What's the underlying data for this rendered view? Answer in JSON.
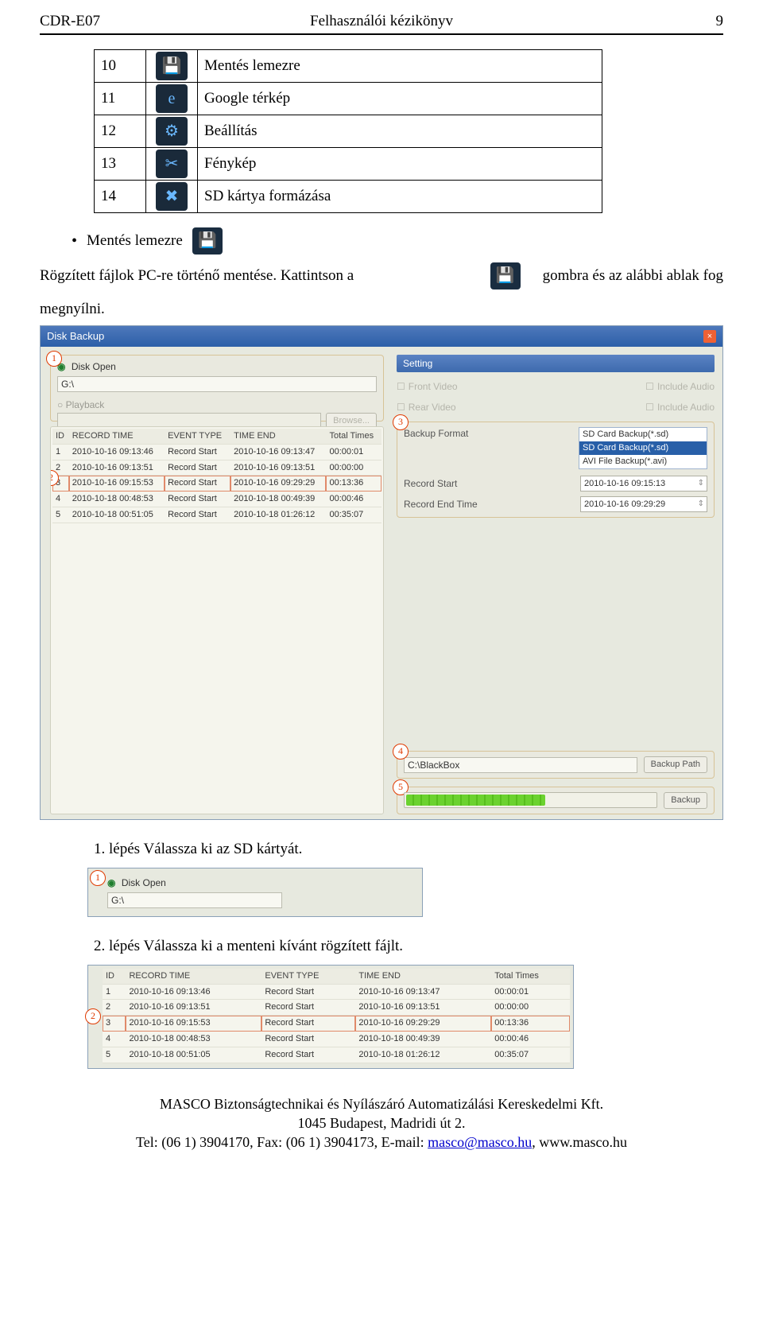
{
  "header": {
    "left": "CDR-E07",
    "center": "Felhasználói kézikönyv",
    "right": "9"
  },
  "iconTable": {
    "rows": [
      {
        "num": "10",
        "icon": "save-icon",
        "glyph": "💾",
        "label": "Mentés lemezre"
      },
      {
        "num": "11",
        "icon": "google-maps-icon",
        "glyph": "e",
        "label": "Google térkép"
      },
      {
        "num": "12",
        "icon": "settings-icon",
        "glyph": "⚙",
        "label": "Beállítás"
      },
      {
        "num": "13",
        "icon": "snapshot-icon",
        "glyph": "✂",
        "label": "Fénykép"
      },
      {
        "num": "14",
        "icon": "format-sd-icon",
        "glyph": "✖",
        "label": "SD kártya formázása"
      }
    ]
  },
  "bullet": {
    "text": "Mentés lemezre",
    "iconName": "save-icon",
    "glyph": "💾"
  },
  "paragraph": {
    "segA": "Rögzített  fájlok  PC-re  történő  mentése.  Kattintson  a",
    "iconName": "save-icon",
    "glyph": "💾",
    "segB": "gombra  és  az  alábbi  ablak  fog",
    "line2": "megnyílni."
  },
  "diskBackup": {
    "title": "Disk Backup",
    "markers": {
      "m1": "1",
      "m2": "2",
      "m3": "3",
      "m4": "4",
      "m5": "5"
    },
    "left": {
      "diskOpen": {
        "label": "Disk Open",
        "value": "G:\\"
      },
      "playback": {
        "label": "Playback",
        "browse": "Browse..."
      },
      "columns": [
        "ID",
        "RECORD TIME",
        "EVENT TYPE",
        "TIME END",
        "Total Times"
      ],
      "rows": [
        {
          "id": "1",
          "rt": "2010-10-16 09:13:46",
          "et": "Record Start",
          "te": "2010-10-16 09:13:47",
          "tt": "00:00:01"
        },
        {
          "id": "2",
          "rt": "2010-10-16 09:13:51",
          "et": "Record Start",
          "te": "2010-10-16 09:13:51",
          "tt": "00:00:00"
        },
        {
          "id": "3",
          "rt": "2010-10-16 09:15:53",
          "et": "Record Start",
          "te": "2010-10-16 09:29:29",
          "tt": "00:13:36",
          "hl": true
        },
        {
          "id": "4",
          "rt": "2010-10-18 00:48:53",
          "et": "Record Start",
          "te": "2010-10-18 00:49:39",
          "tt": "00:00:46"
        },
        {
          "id": "5",
          "rt": "2010-10-18 00:51:05",
          "et": "Record Start",
          "te": "2010-10-18 01:26:12",
          "tt": "00:35:07"
        }
      ]
    },
    "right": {
      "settingHead": "Setting",
      "frontVideo": "Front Video",
      "rearVideo": "Rear Video",
      "includeAudio": "Include Audio",
      "backupFormatLabel": "Backup Format",
      "formats": [
        {
          "text": "SD Card Backup(*.sd)",
          "sel": false
        },
        {
          "text": "SD Card Backup(*.sd)",
          "sel": true
        },
        {
          "text": "AVI File Backup(*.avi)",
          "sel": false
        }
      ],
      "recordStartLabel": "Record Start",
      "recordStartValue": "2010-10-16 09:15:13",
      "recordEndLabel": "Record End Time",
      "recordEndValue": "2010-10-16 09:29:29",
      "pathValue": "C:\\BlackBox",
      "backupPathBtn": "Backup Path",
      "backupBtn": "Backup"
    }
  },
  "steps": {
    "s1": "1. lépés   Válassza ki az SD kártyát.",
    "s2": "2. lépés   Válassza ki a menteni kívánt rögzített fájlt."
  },
  "snippetDisk": {
    "marker": "1",
    "label": "Disk Open",
    "value": "G:\\"
  },
  "snippetTable": {
    "marker": "2",
    "columns": [
      "ID",
      "RECORD TIME",
      "EVENT TYPE",
      "TIME END",
      "Total Times"
    ],
    "rows": [
      {
        "id": "1",
        "rt": "2010-10-16 09:13:46",
        "et": "Record Start",
        "te": "2010-10-16 09:13:47",
        "tt": "00:00:01"
      },
      {
        "id": "2",
        "rt": "2010-10-16 09:13:51",
        "et": "Record Start",
        "te": "2010-10-16 09:13:51",
        "tt": "00:00:00"
      },
      {
        "id": "3",
        "rt": "2010-10-16 09:15:53",
        "et": "Record Start",
        "te": "2010-10-16 09:29:29",
        "tt": "00:13:36",
        "hl": true
      },
      {
        "id": "4",
        "rt": "2010-10-18 00:48:53",
        "et": "Record Start",
        "te": "2010-10-18 00:49:39",
        "tt": "00:00:46"
      },
      {
        "id": "5",
        "rt": "2010-10-18 00:51:05",
        "et": "Record Start",
        "te": "2010-10-18 01:26:12",
        "tt": "00:35:07"
      }
    ]
  },
  "footer": {
    "line1": "MASCO Biztonságtechnikai és Nyílászáró Automatizálási Kereskedelmi Kft.",
    "line2": "1045 Budapest, Madridi út 2.",
    "line3a": "Tel: (06 1) 3904170, Fax: (06 1) 3904173, E-mail: ",
    "email": "masco@masco.hu",
    "line3b": ", www.masco.hu"
  }
}
